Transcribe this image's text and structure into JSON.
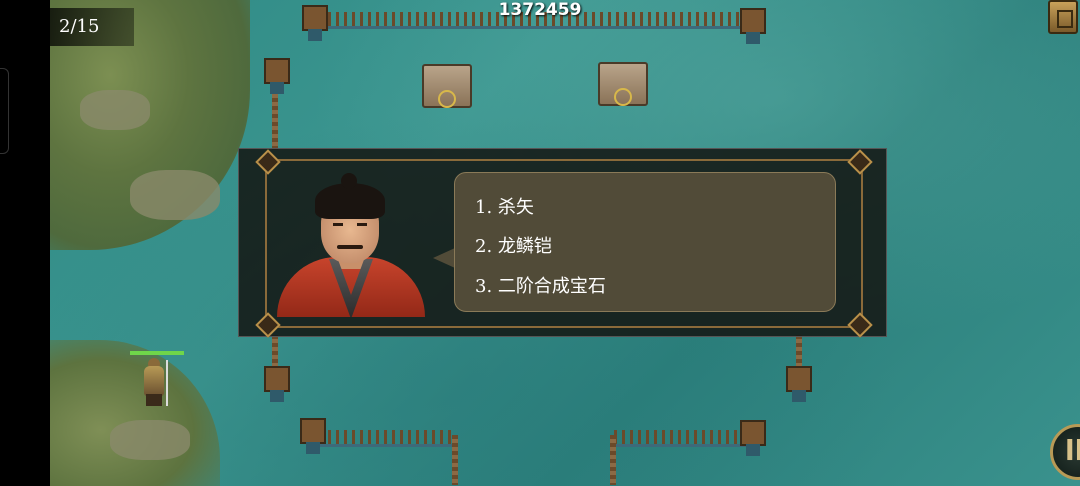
{
  "hud": {
    "score": "1372459",
    "turn_counter": "2/15",
    "pause_icon": "pause-icon",
    "menu_icon": "scroll-icon"
  },
  "dialog": {
    "speaker_portrait": "general-portrait",
    "options": [
      "1. 杀矢",
      "2. 龙鳞铠",
      "3. 二阶合成宝石"
    ]
  },
  "unit": {
    "hp_fraction": 1.0
  },
  "colors": {
    "water": "#3a928d",
    "frame": "#8a6a3a",
    "hp": "#6fd64a"
  }
}
